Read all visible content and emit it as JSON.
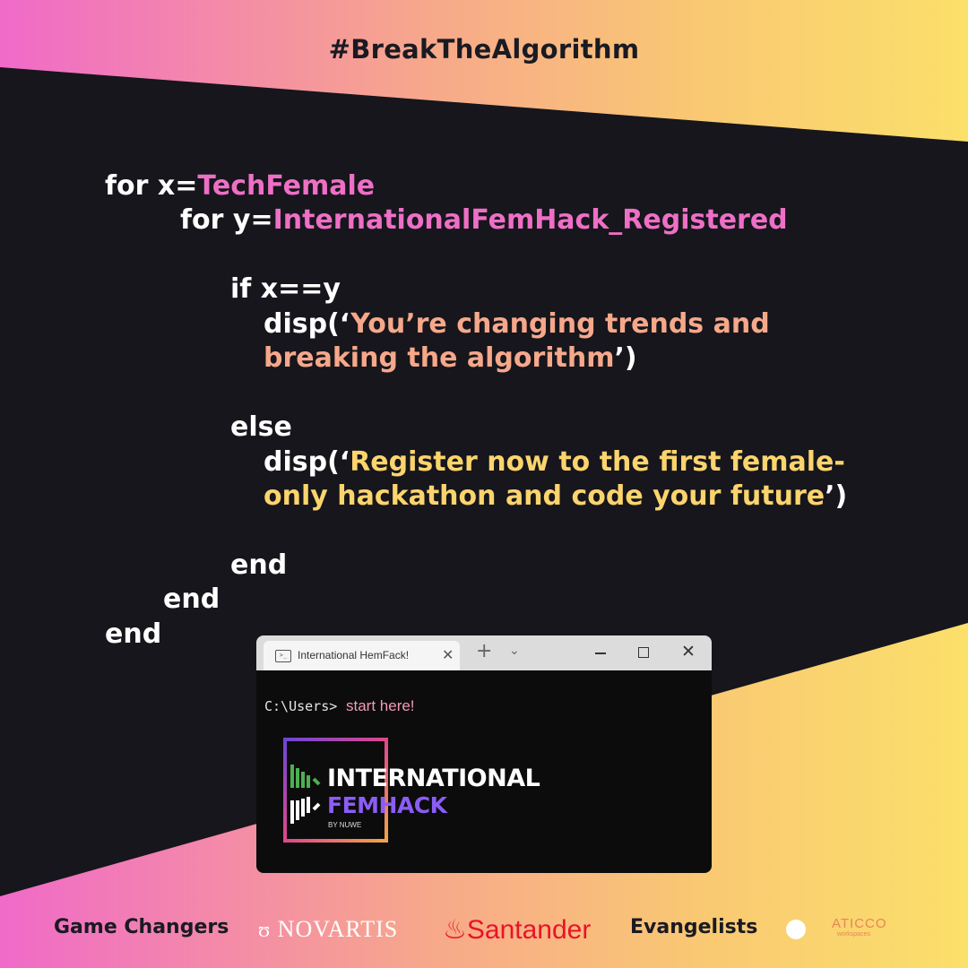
{
  "hashtag": "#BreakTheAlgorithm",
  "code": {
    "line1_kw": "for x=",
    "line1_val": "TechFemale",
    "line2_kw": "for y=",
    "line2_val": "InternationalFemHack_Registered",
    "line3": "if x==y",
    "line4_kw": "disp(‘",
    "line4_val": "You’re changing trends and",
    "line5_val": "breaking the algorithm",
    "line5_end": "’)",
    "line6": "else",
    "line7_kw": "disp(‘",
    "line7_val": "Register now to the first female-",
    "line8_val": "only hackathon and code your future",
    "line8_end": "’)",
    "end1": "end",
    "end2": "end",
    "end3": "end"
  },
  "terminal": {
    "tab_title": "International HemFack!",
    "prompt": "C:\\Users>",
    "command": "start here!",
    "logo_line1": "INTERNATIONAL",
    "logo_line2": "FEMHACK",
    "logo_line3": "BY NUWE"
  },
  "footer": {
    "game_changers": "Game Changers",
    "novartis": "NOVARTIS",
    "santander": "Santander",
    "evangelists": "Evangelists",
    "aticco": "ATICCO",
    "aticco_sub": "workspaces"
  },
  "icons": [
    "terminal-icon",
    "close-icon",
    "plus-icon",
    "chevron-down-icon",
    "minimize-icon",
    "maximize-icon",
    "flame-icon"
  ],
  "colors": {
    "pink": "#ee6fc6",
    "peach": "#f6a88a",
    "yellow": "#fbd46d",
    "dark": "#16161c",
    "santander_red": "#e8132a"
  }
}
